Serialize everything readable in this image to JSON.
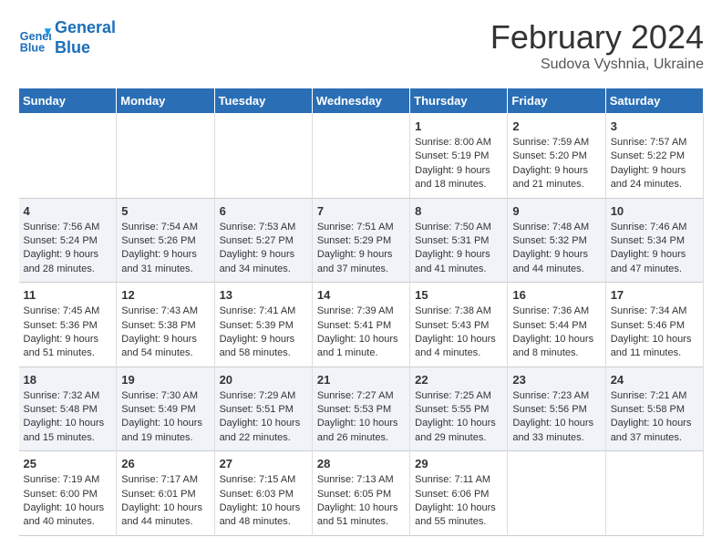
{
  "logo": {
    "line1": "General",
    "line2": "Blue"
  },
  "title": "February 2024",
  "subtitle": "Sudova Vyshnia, Ukraine",
  "weekdays": [
    "Sunday",
    "Monday",
    "Tuesday",
    "Wednesday",
    "Thursday",
    "Friday",
    "Saturday"
  ],
  "weeks": [
    [
      {
        "day": "",
        "info": ""
      },
      {
        "day": "",
        "info": ""
      },
      {
        "day": "",
        "info": ""
      },
      {
        "day": "",
        "info": ""
      },
      {
        "day": "1",
        "info": "Sunrise: 8:00 AM\nSunset: 5:19 PM\nDaylight: 9 hours\nand 18 minutes."
      },
      {
        "day": "2",
        "info": "Sunrise: 7:59 AM\nSunset: 5:20 PM\nDaylight: 9 hours\nand 21 minutes."
      },
      {
        "day": "3",
        "info": "Sunrise: 7:57 AM\nSunset: 5:22 PM\nDaylight: 9 hours\nand 24 minutes."
      }
    ],
    [
      {
        "day": "4",
        "info": "Sunrise: 7:56 AM\nSunset: 5:24 PM\nDaylight: 9 hours\nand 28 minutes."
      },
      {
        "day": "5",
        "info": "Sunrise: 7:54 AM\nSunset: 5:26 PM\nDaylight: 9 hours\nand 31 minutes."
      },
      {
        "day": "6",
        "info": "Sunrise: 7:53 AM\nSunset: 5:27 PM\nDaylight: 9 hours\nand 34 minutes."
      },
      {
        "day": "7",
        "info": "Sunrise: 7:51 AM\nSunset: 5:29 PM\nDaylight: 9 hours\nand 37 minutes."
      },
      {
        "day": "8",
        "info": "Sunrise: 7:50 AM\nSunset: 5:31 PM\nDaylight: 9 hours\nand 41 minutes."
      },
      {
        "day": "9",
        "info": "Sunrise: 7:48 AM\nSunset: 5:32 PM\nDaylight: 9 hours\nand 44 minutes."
      },
      {
        "day": "10",
        "info": "Sunrise: 7:46 AM\nSunset: 5:34 PM\nDaylight: 9 hours\nand 47 minutes."
      }
    ],
    [
      {
        "day": "11",
        "info": "Sunrise: 7:45 AM\nSunset: 5:36 PM\nDaylight: 9 hours\nand 51 minutes."
      },
      {
        "day": "12",
        "info": "Sunrise: 7:43 AM\nSunset: 5:38 PM\nDaylight: 9 hours\nand 54 minutes."
      },
      {
        "day": "13",
        "info": "Sunrise: 7:41 AM\nSunset: 5:39 PM\nDaylight: 9 hours\nand 58 minutes."
      },
      {
        "day": "14",
        "info": "Sunrise: 7:39 AM\nSunset: 5:41 PM\nDaylight: 10 hours\nand 1 minute."
      },
      {
        "day": "15",
        "info": "Sunrise: 7:38 AM\nSunset: 5:43 PM\nDaylight: 10 hours\nand 4 minutes."
      },
      {
        "day": "16",
        "info": "Sunrise: 7:36 AM\nSunset: 5:44 PM\nDaylight: 10 hours\nand 8 minutes."
      },
      {
        "day": "17",
        "info": "Sunrise: 7:34 AM\nSunset: 5:46 PM\nDaylight: 10 hours\nand 11 minutes."
      }
    ],
    [
      {
        "day": "18",
        "info": "Sunrise: 7:32 AM\nSunset: 5:48 PM\nDaylight: 10 hours\nand 15 minutes."
      },
      {
        "day": "19",
        "info": "Sunrise: 7:30 AM\nSunset: 5:49 PM\nDaylight: 10 hours\nand 19 minutes."
      },
      {
        "day": "20",
        "info": "Sunrise: 7:29 AM\nSunset: 5:51 PM\nDaylight: 10 hours\nand 22 minutes."
      },
      {
        "day": "21",
        "info": "Sunrise: 7:27 AM\nSunset: 5:53 PM\nDaylight: 10 hours\nand 26 minutes."
      },
      {
        "day": "22",
        "info": "Sunrise: 7:25 AM\nSunset: 5:55 PM\nDaylight: 10 hours\nand 29 minutes."
      },
      {
        "day": "23",
        "info": "Sunrise: 7:23 AM\nSunset: 5:56 PM\nDaylight: 10 hours\nand 33 minutes."
      },
      {
        "day": "24",
        "info": "Sunrise: 7:21 AM\nSunset: 5:58 PM\nDaylight: 10 hours\nand 37 minutes."
      }
    ],
    [
      {
        "day": "25",
        "info": "Sunrise: 7:19 AM\nSunset: 6:00 PM\nDaylight: 10 hours\nand 40 minutes."
      },
      {
        "day": "26",
        "info": "Sunrise: 7:17 AM\nSunset: 6:01 PM\nDaylight: 10 hours\nand 44 minutes."
      },
      {
        "day": "27",
        "info": "Sunrise: 7:15 AM\nSunset: 6:03 PM\nDaylight: 10 hours\nand 48 minutes."
      },
      {
        "day": "28",
        "info": "Sunrise: 7:13 AM\nSunset: 6:05 PM\nDaylight: 10 hours\nand 51 minutes."
      },
      {
        "day": "29",
        "info": "Sunrise: 7:11 AM\nSunset: 6:06 PM\nDaylight: 10 hours\nand 55 minutes."
      },
      {
        "day": "",
        "info": ""
      },
      {
        "day": "",
        "info": ""
      }
    ]
  ]
}
